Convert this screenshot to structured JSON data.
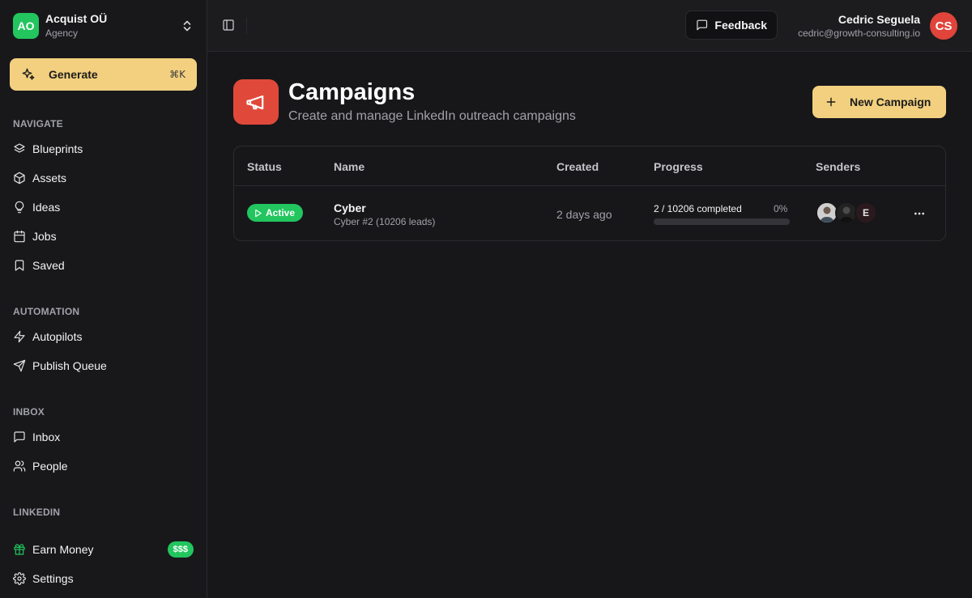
{
  "org": {
    "initials": "AO",
    "name": "Acquist OÜ",
    "type": "Agency"
  },
  "generate": {
    "label": "Generate",
    "shortcut": "⌘K"
  },
  "nav": {
    "navigate_label": "NAVIGATE",
    "navigate": [
      {
        "label": "Blueprints",
        "icon": "layers-icon"
      },
      {
        "label": "Assets",
        "icon": "box-icon"
      },
      {
        "label": "Ideas",
        "icon": "lightbulb-icon"
      },
      {
        "label": "Jobs",
        "icon": "calendar-icon"
      },
      {
        "label": "Saved",
        "icon": "bookmark-icon"
      }
    ],
    "automation_label": "AUTOMATION",
    "automation": [
      {
        "label": "Autopilots",
        "icon": "zap-icon"
      },
      {
        "label": "Publish Queue",
        "icon": "send-icon"
      }
    ],
    "inbox_label": "INBOX",
    "inbox": [
      {
        "label": "Inbox",
        "icon": "message-icon"
      },
      {
        "label": "People",
        "icon": "users-icon"
      }
    ],
    "linkedin_label": "LINKEDIN",
    "earn": {
      "label": "Earn Money",
      "badge": "$$$",
      "icon": "gift-icon"
    },
    "settings": {
      "label": "Settings",
      "icon": "gear-icon"
    }
  },
  "topbar": {
    "feedback_label": "Feedback",
    "user_name": "Cedric Seguela",
    "user_email": "cedric@growth-consulting.io",
    "user_initials": "CS"
  },
  "page": {
    "title": "Campaigns",
    "subtitle": "Create and manage LinkedIn outreach campaigns",
    "new_button": "New Campaign"
  },
  "table": {
    "headers": [
      "Status",
      "Name",
      "Created",
      "Progress",
      "Senders"
    ],
    "rows": [
      {
        "status": "Active",
        "name": "Cyber",
        "sub": "Cyber #2 (10206 leads)",
        "created": "2 days ago",
        "progress_text": "2 / 10206 completed",
        "progress_pct": "0%",
        "progress_value": 0.0002,
        "senders": [
          "",
          "",
          "E"
        ]
      }
    ]
  },
  "colors": {
    "accent": "#f2d07f",
    "success": "#22c55e",
    "danger": "#e0493a",
    "bg": "#17171a"
  }
}
